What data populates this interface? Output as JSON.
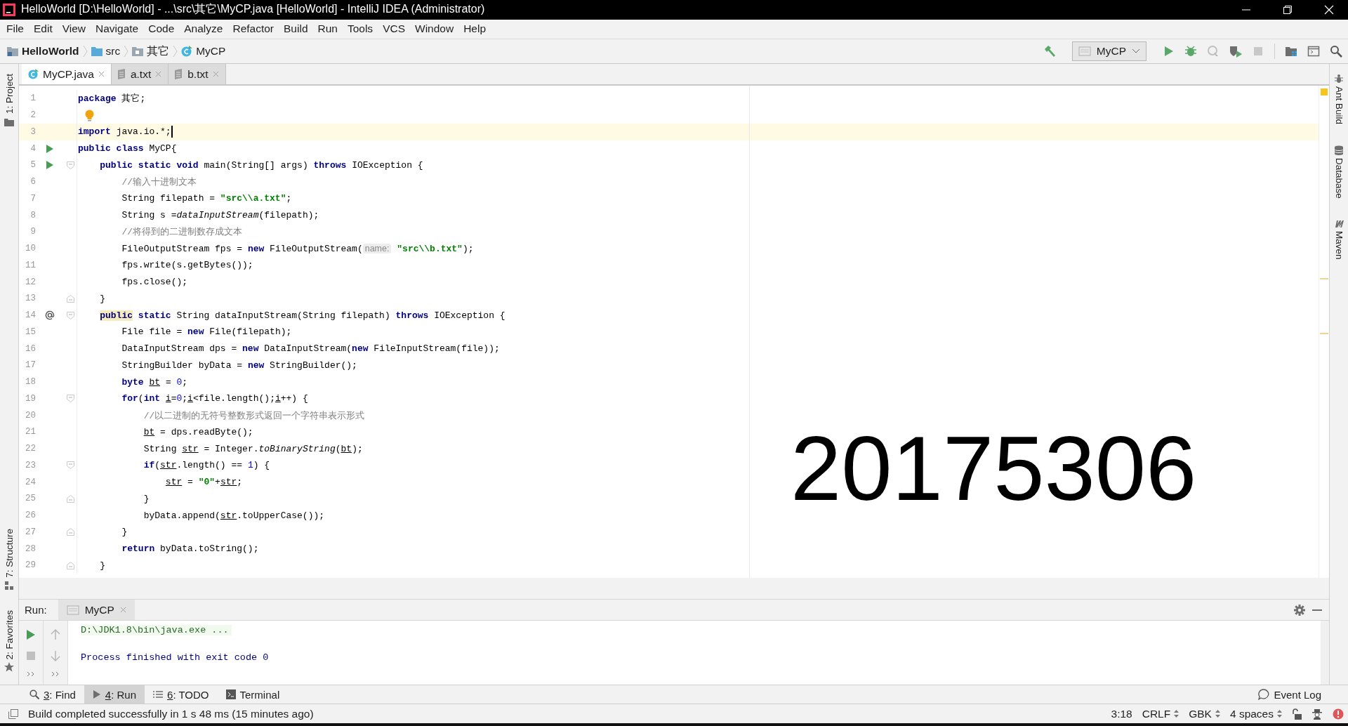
{
  "window": {
    "title": "HelloWorld [D:\\HelloWorld] - ...\\src\\其它\\MyCP.java [HelloWorld] - IntelliJ IDEA (Administrator)"
  },
  "menu": [
    "File",
    "Edit",
    "View",
    "Navigate",
    "Code",
    "Analyze",
    "Refactor",
    "Build",
    "Run",
    "Tools",
    "VCS",
    "Window",
    "Help"
  ],
  "breadcrumbs": [
    {
      "label": "HelloWorld",
      "kind": "project"
    },
    {
      "label": "src",
      "kind": "source"
    },
    {
      "label": "其它",
      "kind": "package"
    },
    {
      "label": "MyCP",
      "kind": "class"
    }
  ],
  "run_config": "MyCP",
  "tabs": [
    {
      "label": "MyCP.java",
      "kind": "class",
      "selected": true
    },
    {
      "label": "a.txt",
      "kind": "text",
      "selected": false
    },
    {
      "label": "b.txt",
      "kind": "text",
      "selected": false
    }
  ],
  "left_tools": {
    "top": [
      "1: Project"
    ],
    "structure": "7: Structure",
    "favorites": "2: Favorites"
  },
  "right_tools": [
    {
      "label": "Ant Build",
      "kind": "ant"
    },
    {
      "label": "Database",
      "kind": "database"
    },
    {
      "label": "Maven",
      "kind": "maven"
    }
  ],
  "editor": {
    "overlay_text": "20175306",
    "lines": [
      {
        "number": "1",
        "current": false,
        "tokens": [
          {
            "t": "package",
            "kind": "keyword"
          },
          {
            "t": " 其它;",
            "kind": "plain"
          }
        ]
      },
      {
        "number": "2",
        "current": false,
        "bulb": true
      },
      {
        "number": "3",
        "current": true,
        "tokens": [
          {
            "t": "import",
            "kind": "keyword"
          },
          {
            "t": " java.io.*;",
            "kind": "plain"
          }
        ]
      },
      {
        "number": "4",
        "current": false,
        "gutter_icon": {
          "kind": "run"
        },
        "tokens": [
          {
            "t": "public class",
            "kind": "keyword"
          },
          {
            "t": " MyCP{",
            "kind": "plain"
          }
        ]
      },
      {
        "number": "5",
        "current": false,
        "gutter_icon": {
          "kind": "run"
        },
        "fold_marker": {
          "kind": "start"
        },
        "tokens": [
          {
            "t": "    public static void",
            "kind": "keyword"
          },
          {
            "t": " main(String[] args) ",
            "kind": "plain"
          },
          {
            "t": "throws",
            "kind": "keyword"
          },
          {
            "t": " IOException {",
            "kind": "plain"
          }
        ]
      },
      {
        "number": "6",
        "current": false,
        "tokens": [
          {
            "t": "        //输入十进制文本",
            "kind": "comment"
          }
        ]
      },
      {
        "number": "7",
        "current": false,
        "tokens": [
          {
            "t": "        String filepath = ",
            "kind": "plain"
          },
          {
            "t": "\"src\\\\a.txt\"",
            "kind": "string"
          },
          {
            "t": ";",
            "kind": "plain"
          }
        ]
      },
      {
        "number": "8",
        "current": false,
        "tokens": [
          {
            "t": "        String s =",
            "kind": "plain"
          },
          {
            "t": "dataInputStream",
            "kind": "italic"
          },
          {
            "t": "(filepath);",
            "kind": "plain"
          }
        ]
      },
      {
        "number": "9",
        "current": false,
        "tokens": [
          {
            "t": "        //将得到的二进制数存成文本",
            "kind": "comment"
          }
        ]
      },
      {
        "number": "10",
        "current": false,
        "tokens": [
          {
            "t": "        FileOutputStream fps = ",
            "kind": "plain"
          },
          {
            "t": "new",
            "kind": "keyword"
          },
          {
            "t": " FileOutputStream(",
            "kind": "plain"
          },
          {
            "t": "name:",
            "kind": "hint"
          },
          {
            "t": " \"src\\\\b.txt\"",
            "kind": "string"
          },
          {
            "t": ");",
            "kind": "plain"
          }
        ]
      },
      {
        "number": "11",
        "current": false,
        "tokens": [
          {
            "t": "        fps.write(s.getBytes());",
            "kind": "plain"
          }
        ]
      },
      {
        "number": "12",
        "current": false,
        "tokens": [
          {
            "t": "        fps.close();",
            "kind": "plain"
          }
        ]
      },
      {
        "number": "13",
        "current": false,
        "fold_marker": {
          "kind": "end"
        },
        "tokens": [
          {
            "t": "    }",
            "kind": "plain"
          }
        ]
      },
      {
        "number": "14",
        "current": false,
        "gutter_icon": {
          "kind": "override"
        },
        "fold_marker": {
          "kind": "start"
        },
        "tokens": [
          {
            "t": "    public",
            "kind": "marked_keyword"
          },
          {
            "t": " static",
            "kind": "keyword"
          },
          {
            "t": " String dataInputStream(String filepath) ",
            "kind": "plain"
          },
          {
            "t": "throws",
            "kind": "keyword"
          },
          {
            "t": " IOException {",
            "kind": "plain"
          }
        ]
      },
      {
        "number": "15",
        "current": false,
        "tokens": [
          {
            "t": "        File file = ",
            "kind": "plain"
          },
          {
            "t": "new",
            "kind": "keyword"
          },
          {
            "t": " File(filepath);",
            "kind": "plain"
          }
        ]
      },
      {
        "number": "16",
        "current": false,
        "tokens": [
          {
            "t": "        DataInputStream dps = ",
            "kind": "plain"
          },
          {
            "t": "new",
            "kind": "keyword"
          },
          {
            "t": " DataInputStream(",
            "kind": "plain"
          },
          {
            "t": "new",
            "kind": "keyword"
          },
          {
            "t": " FileInputStream(file));",
            "kind": "plain"
          }
        ]
      },
      {
        "number": "17",
        "current": false,
        "tokens": [
          {
            "t": "        StringBuilder byData = ",
            "kind": "plain"
          },
          {
            "t": "new",
            "kind": "keyword"
          },
          {
            "t": " StringBuilder();",
            "kind": "plain"
          }
        ]
      },
      {
        "number": "18",
        "current": false,
        "tokens": [
          {
            "t": "        byte",
            "kind": "keyword"
          },
          {
            "t": " bt",
            "kind": "variable"
          },
          {
            "t": " = ",
            "kind": "plain"
          },
          {
            "t": "0",
            "kind": "number"
          },
          {
            "t": ";",
            "kind": "plain"
          }
        ]
      },
      {
        "number": "19",
        "current": false,
        "fold_marker": {
          "kind": "start"
        },
        "tokens": [
          {
            "t": "        for",
            "kind": "keyword"
          },
          {
            "t": "(",
            "kind": "plain"
          },
          {
            "t": "int",
            "kind": "keyword"
          },
          {
            "t": " i",
            "kind": "variable"
          },
          {
            "t": "=",
            "kind": "plain"
          },
          {
            "t": "0",
            "kind": "number"
          },
          {
            "t": ";",
            "kind": "plain"
          },
          {
            "t": "i",
            "kind": "variable"
          },
          {
            "t": "<file.length();",
            "kind": "plain"
          },
          {
            "t": "i",
            "kind": "variable"
          },
          {
            "t": "++) {",
            "kind": "plain"
          }
        ]
      },
      {
        "number": "20",
        "current": false,
        "tokens": [
          {
            "t": "            //以二进制的无符号整数形式返回一个字符串表示形式",
            "kind": "comment"
          }
        ]
      },
      {
        "number": "21",
        "current": false,
        "tokens": [
          {
            "t": "            bt",
            "kind": "variable"
          },
          {
            "t": " = dps.readByte();",
            "kind": "plain"
          }
        ]
      },
      {
        "number": "22",
        "current": false,
        "tokens": [
          {
            "t": "            String ",
            "kind": "plain"
          },
          {
            "t": "str",
            "kind": "variable"
          },
          {
            "t": " = Integer.",
            "kind": "plain"
          },
          {
            "t": "toBinaryString",
            "kind": "italic"
          },
          {
            "t": "(",
            "kind": "plain"
          },
          {
            "t": "bt",
            "kind": "variable"
          },
          {
            "t": ");",
            "kind": "plain"
          }
        ]
      },
      {
        "number": "23",
        "current": false,
        "fold_marker": {
          "kind": "start"
        },
        "tokens": [
          {
            "t": "            if",
            "kind": "keyword"
          },
          {
            "t": "(",
            "kind": "plain"
          },
          {
            "t": "str",
            "kind": "variable"
          },
          {
            "t": ".length() == ",
            "kind": "plain"
          },
          {
            "t": "1",
            "kind": "number"
          },
          {
            "t": ") {",
            "kind": "plain"
          }
        ]
      },
      {
        "number": "24",
        "current": false,
        "tokens": [
          {
            "t": "                str",
            "kind": "variable"
          },
          {
            "t": " = ",
            "kind": "plain"
          },
          {
            "t": "\"0\"",
            "kind": "string"
          },
          {
            "t": "+",
            "kind": "plain"
          },
          {
            "t": "str",
            "kind": "variable"
          },
          {
            "t": ";",
            "kind": "plain"
          }
        ]
      },
      {
        "number": "25",
        "current": false,
        "fold_marker": {
          "kind": "end"
        },
        "tokens": [
          {
            "t": "            }",
            "kind": "plain"
          }
        ]
      },
      {
        "number": "26",
        "current": false,
        "tokens": [
          {
            "t": "            byData.append(",
            "kind": "plain"
          },
          {
            "t": "str",
            "kind": "variable"
          },
          {
            "t": ".toUpperCase());",
            "kind": "plain"
          }
        ]
      },
      {
        "number": "27",
        "current": false,
        "fold_marker": {
          "kind": "end"
        },
        "tokens": [
          {
            "t": "        }",
            "kind": "plain"
          }
        ]
      },
      {
        "number": "28",
        "current": false,
        "tokens": [
          {
            "t": "        return",
            "kind": "keyword"
          },
          {
            "t": " byData.toString();",
            "kind": "plain"
          }
        ]
      },
      {
        "number": "29",
        "current": false,
        "fold_marker": {
          "kind": "end"
        },
        "tokens": [
          {
            "t": "    }",
            "kind": "plain"
          }
        ]
      }
    ]
  },
  "run_panel": {
    "label": "Run:",
    "tab": "MyCP",
    "output": [
      {
        "text": "D:\\JDK1.8\\bin\\java.exe ...",
        "kind": "command"
      },
      {
        "text": "Process finished with exit code 0",
        "kind": "info"
      }
    ]
  },
  "tool_tabs": [
    {
      "key": "3",
      "label": ": Find",
      "kind": "find",
      "selected": false
    },
    {
      "key": "4",
      "label": ": Run",
      "kind": "run",
      "selected": true
    },
    {
      "key": "6",
      "label": ": TODO",
      "kind": "todo",
      "selected": false
    },
    {
      "label": "Terminal",
      "kind": "terminal",
      "selected": false
    }
  ],
  "event_log": "Event Log",
  "status_bar": {
    "message": "Build completed successfully in 1 s 48 ms (15 minutes ago)",
    "items": [
      {
        "text": "3:18",
        "kind": "plain"
      },
      {
        "text": "CRLF",
        "kind": "select"
      },
      {
        "text": "GBK",
        "kind": "select"
      },
      {
        "text": "4 spaces",
        "kind": "select"
      }
    ]
  }
}
